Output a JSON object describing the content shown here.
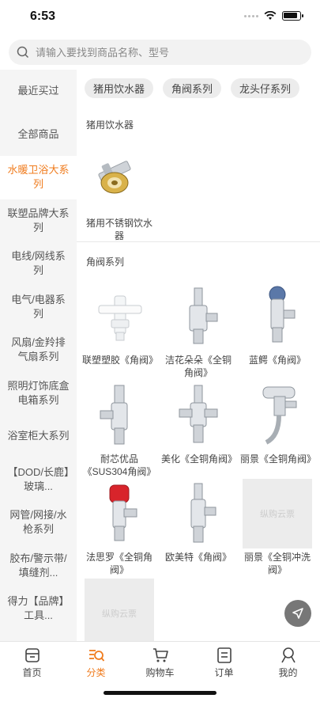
{
  "status": {
    "time": "6:53"
  },
  "search": {
    "placeholder": "请输入要找到商品名称、型号"
  },
  "sidebar": {
    "items": [
      {
        "label": "最近买过"
      },
      {
        "label": "全部商品"
      },
      {
        "label": "水暖卫浴大系列",
        "active": true
      },
      {
        "label": "联塑品牌大系列"
      },
      {
        "label": "电线/网线系列"
      },
      {
        "label": "电气/电器系列"
      },
      {
        "label": "风扇/金羚排气扇系列"
      },
      {
        "label": "照明灯饰底盒电箱系列"
      },
      {
        "label": "浴室柜大系列"
      },
      {
        "label": "【DOD/长鹿】玻璃..."
      },
      {
        "label": "网管/网接/水枪系列"
      },
      {
        "label": "胶布/警示带/填缝剂..."
      },
      {
        "label": "得力【品牌】工具..."
      }
    ]
  },
  "chips": [
    "猪用饮水器",
    "角阀系列",
    "龙头仔系列"
  ],
  "sections": [
    {
      "title": "猪用饮水器",
      "products": [
        {
          "name": "猪用不锈钢饮水器"
        }
      ]
    },
    {
      "title": "角阀系列",
      "products": [
        {
          "name": "联塑塑胶《角阀》"
        },
        {
          "name": "洁花朵朵《全铜角阀》"
        },
        {
          "name": "蓝鳄《角阀》"
        },
        {
          "name": "耐芯优品《SUS304角阀》"
        },
        {
          "name": "美化《全铜角阀》"
        },
        {
          "name": "丽景《全铜角阀》"
        },
        {
          "name": "法思罗《全铜角阀》"
        },
        {
          "name": "欧美特《角阀》"
        },
        {
          "name": "丽景《全铜冲洗阀》"
        }
      ]
    }
  ],
  "watermark": "纵购云票",
  "tabbar": [
    {
      "label": "首页"
    },
    {
      "label": "分类",
      "active": true
    },
    {
      "label": "购物车"
    },
    {
      "label": "订单"
    },
    {
      "label": "我的"
    }
  ],
  "colors": {
    "accent": "#f07c1e",
    "sidebar_bg": "#f5f5f5",
    "chip_bg": "#ececec"
  }
}
